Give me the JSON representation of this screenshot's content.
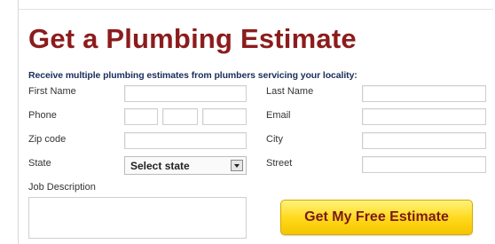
{
  "form": {
    "title": "Get a Plumbing Estimate",
    "subtitle": "Receive multiple plumbing estimates from plumbers servicing your locality:",
    "labels": {
      "first_name": "First Name",
      "last_name": "Last Name",
      "phone": "Phone",
      "email": "Email",
      "zip_code": "Zip code",
      "city": "City",
      "state": "State",
      "street": "Street",
      "job_description": "Job Description"
    },
    "state_select": {
      "selected": "Select state"
    },
    "submit_label": "Get My Free Estimate"
  },
  "colors": {
    "title": "#8c1c1c",
    "subtitle": "#1a2d5a",
    "button_top": "#fff37a",
    "button_bottom": "#f5c500"
  }
}
